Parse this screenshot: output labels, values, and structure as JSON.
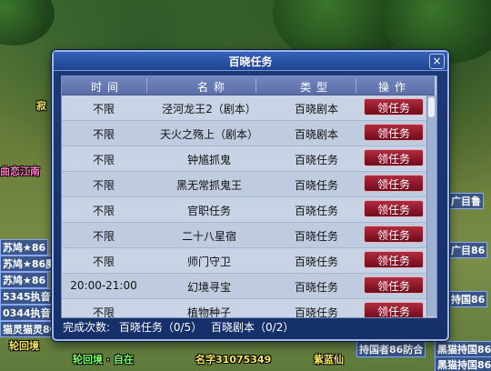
{
  "dialog": {
    "title": "百晓任务",
    "close_label": "×",
    "headers": {
      "time": "时间",
      "name": "名称",
      "type": "类型",
      "action": "操作"
    },
    "rows": [
      {
        "time": "不限",
        "name": "泾河龙王2（剧本）",
        "type": "百晓剧本",
        "action": "领任务"
      },
      {
        "time": "不限",
        "name": "天火之殇上（剧本）",
        "type": "百晓剧本",
        "action": "领任务"
      },
      {
        "time": "不限",
        "name": "钟馗抓鬼",
        "type": "百晓任务",
        "action": "领任务"
      },
      {
        "time": "不限",
        "name": "黑无常抓鬼王",
        "type": "百晓任务",
        "action": "领任务"
      },
      {
        "time": "不限",
        "name": "官职任务",
        "type": "百晓任务",
        "action": "领任务"
      },
      {
        "time": "不限",
        "name": "二十八星宿",
        "type": "百晓任务",
        "action": "领任务"
      },
      {
        "time": "不限",
        "name": "师门守卫",
        "type": "百晓任务",
        "action": "领任务"
      },
      {
        "time": "20:00-21:00",
        "name": "幻境寻宝",
        "type": "百晓任务",
        "action": "领任务"
      },
      {
        "time": "不限",
        "name": "植物种子",
        "type": "百晓任务",
        "action": "领任务"
      }
    ],
    "footer": {
      "label": "完成次数:",
      "task_count": "百晓任务（0/5）",
      "script_count": "百晓剧本（0/2）"
    }
  },
  "background_labels": {
    "l1": "寂",
    "l2": "苏鸠★86",
    "l3": "苏鸠★86魔",
    "l4": "苏鸠★86",
    "l5": "5345执音86",
    "l6": "0344执音86",
    "l7": "猫灵猫灵80",
    "l8": "轮回境",
    "l9": "轮回境 · 自在",
    "l10": "名字31075349",
    "l11": "紫蓝仙",
    "l12": "持国者86防合",
    "l13": "黑猫持国86",
    "l14": "曲恋江南",
    "l15": "广目鲁",
    "l16": "持国86",
    "l17": "广目86",
    "l18": "黑猫持国86"
  },
  "colors": {
    "dialog_bg": "#1d3a78",
    "button_bg": "#8a1628",
    "table_bg": "#c8d4e6"
  }
}
